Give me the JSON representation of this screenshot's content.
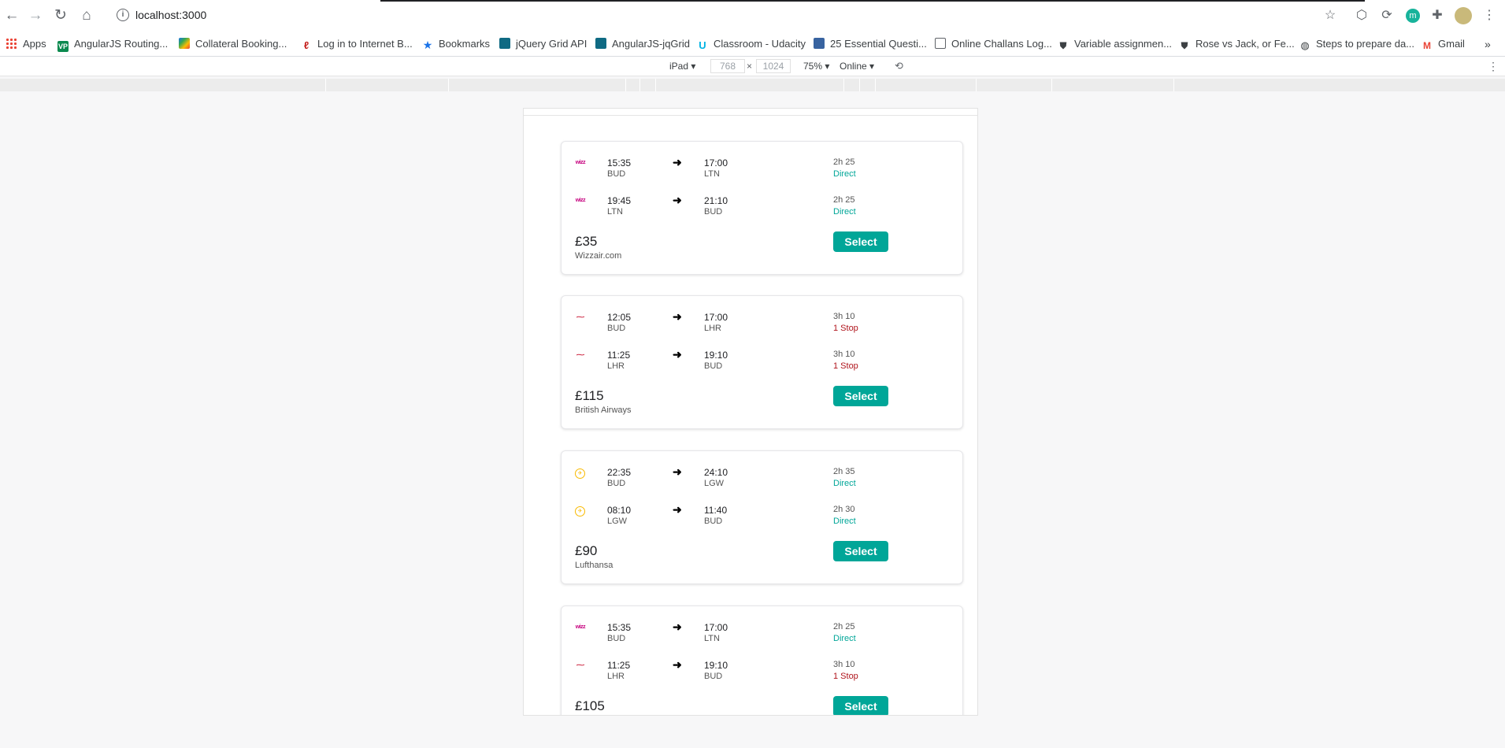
{
  "browser": {
    "url": "localhost:3000",
    "nav_icons": [
      "back-icon",
      "forward-icon",
      "reload-icon",
      "home-icon"
    ],
    "toolbar_icons": [
      "star-icon",
      "extension-cube-icon",
      "sync-icon",
      "extension-m-icon",
      "puzzle-icon",
      "avatar",
      "kebab-menu-icon"
    ],
    "extension_m_label": "m"
  },
  "bookmarks": [
    {
      "label": "Apps",
      "icon": "apps-grid-icon"
    },
    {
      "label": "AngularJS Routing...",
      "icon": "vp-icon"
    },
    {
      "label": "Collateral Booking...",
      "icon": "colorful-book-icon"
    },
    {
      "label": "Log in to Internet B...",
      "icon": "bank-logo-icon"
    },
    {
      "label": "Bookmarks",
      "icon": "star-icon"
    },
    {
      "label": "jQuery Grid API",
      "icon": "jqgrid-icon"
    },
    {
      "label": "AngularJS-jqGrid",
      "icon": "jqgrid-icon"
    },
    {
      "label": "Classroom - Udacity",
      "icon": "udacity-icon"
    },
    {
      "label": "25 Essential Questi...",
      "icon": "toptal-icon"
    },
    {
      "label": "Online Challans Log...",
      "icon": "page-icon"
    },
    {
      "label": "Variable assignmen...",
      "icon": "shield-icon"
    },
    {
      "label": "Rose vs Jack, or Fe...",
      "icon": "shield-icon"
    },
    {
      "label": "Steps to prepare da...",
      "icon": "globe-icon"
    },
    {
      "label": "Gmail",
      "icon": "gmail-icon"
    }
  ],
  "devtools": {
    "device": "iPad",
    "width": "768",
    "times": "×",
    "height": "1024",
    "zoom": "75%",
    "network": "Online"
  },
  "itineraries": [
    {
      "legs": [
        {
          "airline_logo": "wizz-logo-icon",
          "logo_text": "wizz",
          "dep_time": "15:35",
          "dep_code": "BUD",
          "arr_time": "17:00",
          "arr_code": "LTN",
          "duration": "2h 25",
          "stops": "Direct",
          "stop_type": "direct"
        },
        {
          "airline_logo": "wizz-logo-icon",
          "logo_text": "wizz",
          "dep_time": "19:45",
          "dep_code": "LTN",
          "arr_time": "21:10",
          "arr_code": "BUD",
          "duration": "2h 25",
          "stops": "Direct",
          "stop_type": "direct"
        }
      ],
      "price": "£35",
      "agent": "Wizzair.com",
      "select_label": "Select"
    },
    {
      "legs": [
        {
          "airline_logo": "ba-logo-icon",
          "logo_text": "⁓",
          "dep_time": "12:05",
          "dep_code": "BUD",
          "arr_time": "17:00",
          "arr_code": "LHR",
          "duration": "3h 10",
          "stops": "1 Stop",
          "stop_type": "onestop"
        },
        {
          "airline_logo": "ba-logo-icon",
          "logo_text": "⁓",
          "dep_time": "11:25",
          "dep_code": "LHR",
          "arr_time": "19:10",
          "arr_code": "BUD",
          "duration": "3h 10",
          "stops": "1 Stop",
          "stop_type": "onestop"
        }
      ],
      "price": "£115",
      "agent": "British Airways",
      "select_label": "Select"
    },
    {
      "legs": [
        {
          "airline_logo": "lufthansa-logo-icon",
          "logo_text": "✈",
          "dep_time": "22:35",
          "dep_code": "BUD",
          "arr_time": "24:10",
          "arr_code": "LGW",
          "duration": "2h 35",
          "stops": "Direct",
          "stop_type": "direct"
        },
        {
          "airline_logo": "lufthansa-logo-icon",
          "logo_text": "✈",
          "dep_time": "08:10",
          "dep_code": "LGW",
          "arr_time": "11:40",
          "arr_code": "BUD",
          "duration": "2h 30",
          "stops": "Direct",
          "stop_type": "direct"
        }
      ],
      "price": "£90",
      "agent": "Lufthansa",
      "select_label": "Select"
    },
    {
      "legs": [
        {
          "airline_logo": "wizz-logo-icon",
          "logo_text": "wizz",
          "dep_time": "15:35",
          "dep_code": "BUD",
          "arr_time": "17:00",
          "arr_code": "LTN",
          "duration": "2h 25",
          "stops": "Direct",
          "stop_type": "direct"
        },
        {
          "airline_logo": "ba-logo-icon",
          "logo_text": "⁓",
          "dep_time": "11:25",
          "dep_code": "LHR",
          "arr_time": "19:10",
          "arr_code": "BUD",
          "duration": "3h 10",
          "stops": "1 Stop",
          "stop_type": "onestop"
        }
      ],
      "price": "£105",
      "agent": "",
      "select_label": "Select"
    }
  ],
  "colors": {
    "accent": "#00a698",
    "stop_warning": "#b0141c",
    "page_background": "#f7f7f8"
  }
}
